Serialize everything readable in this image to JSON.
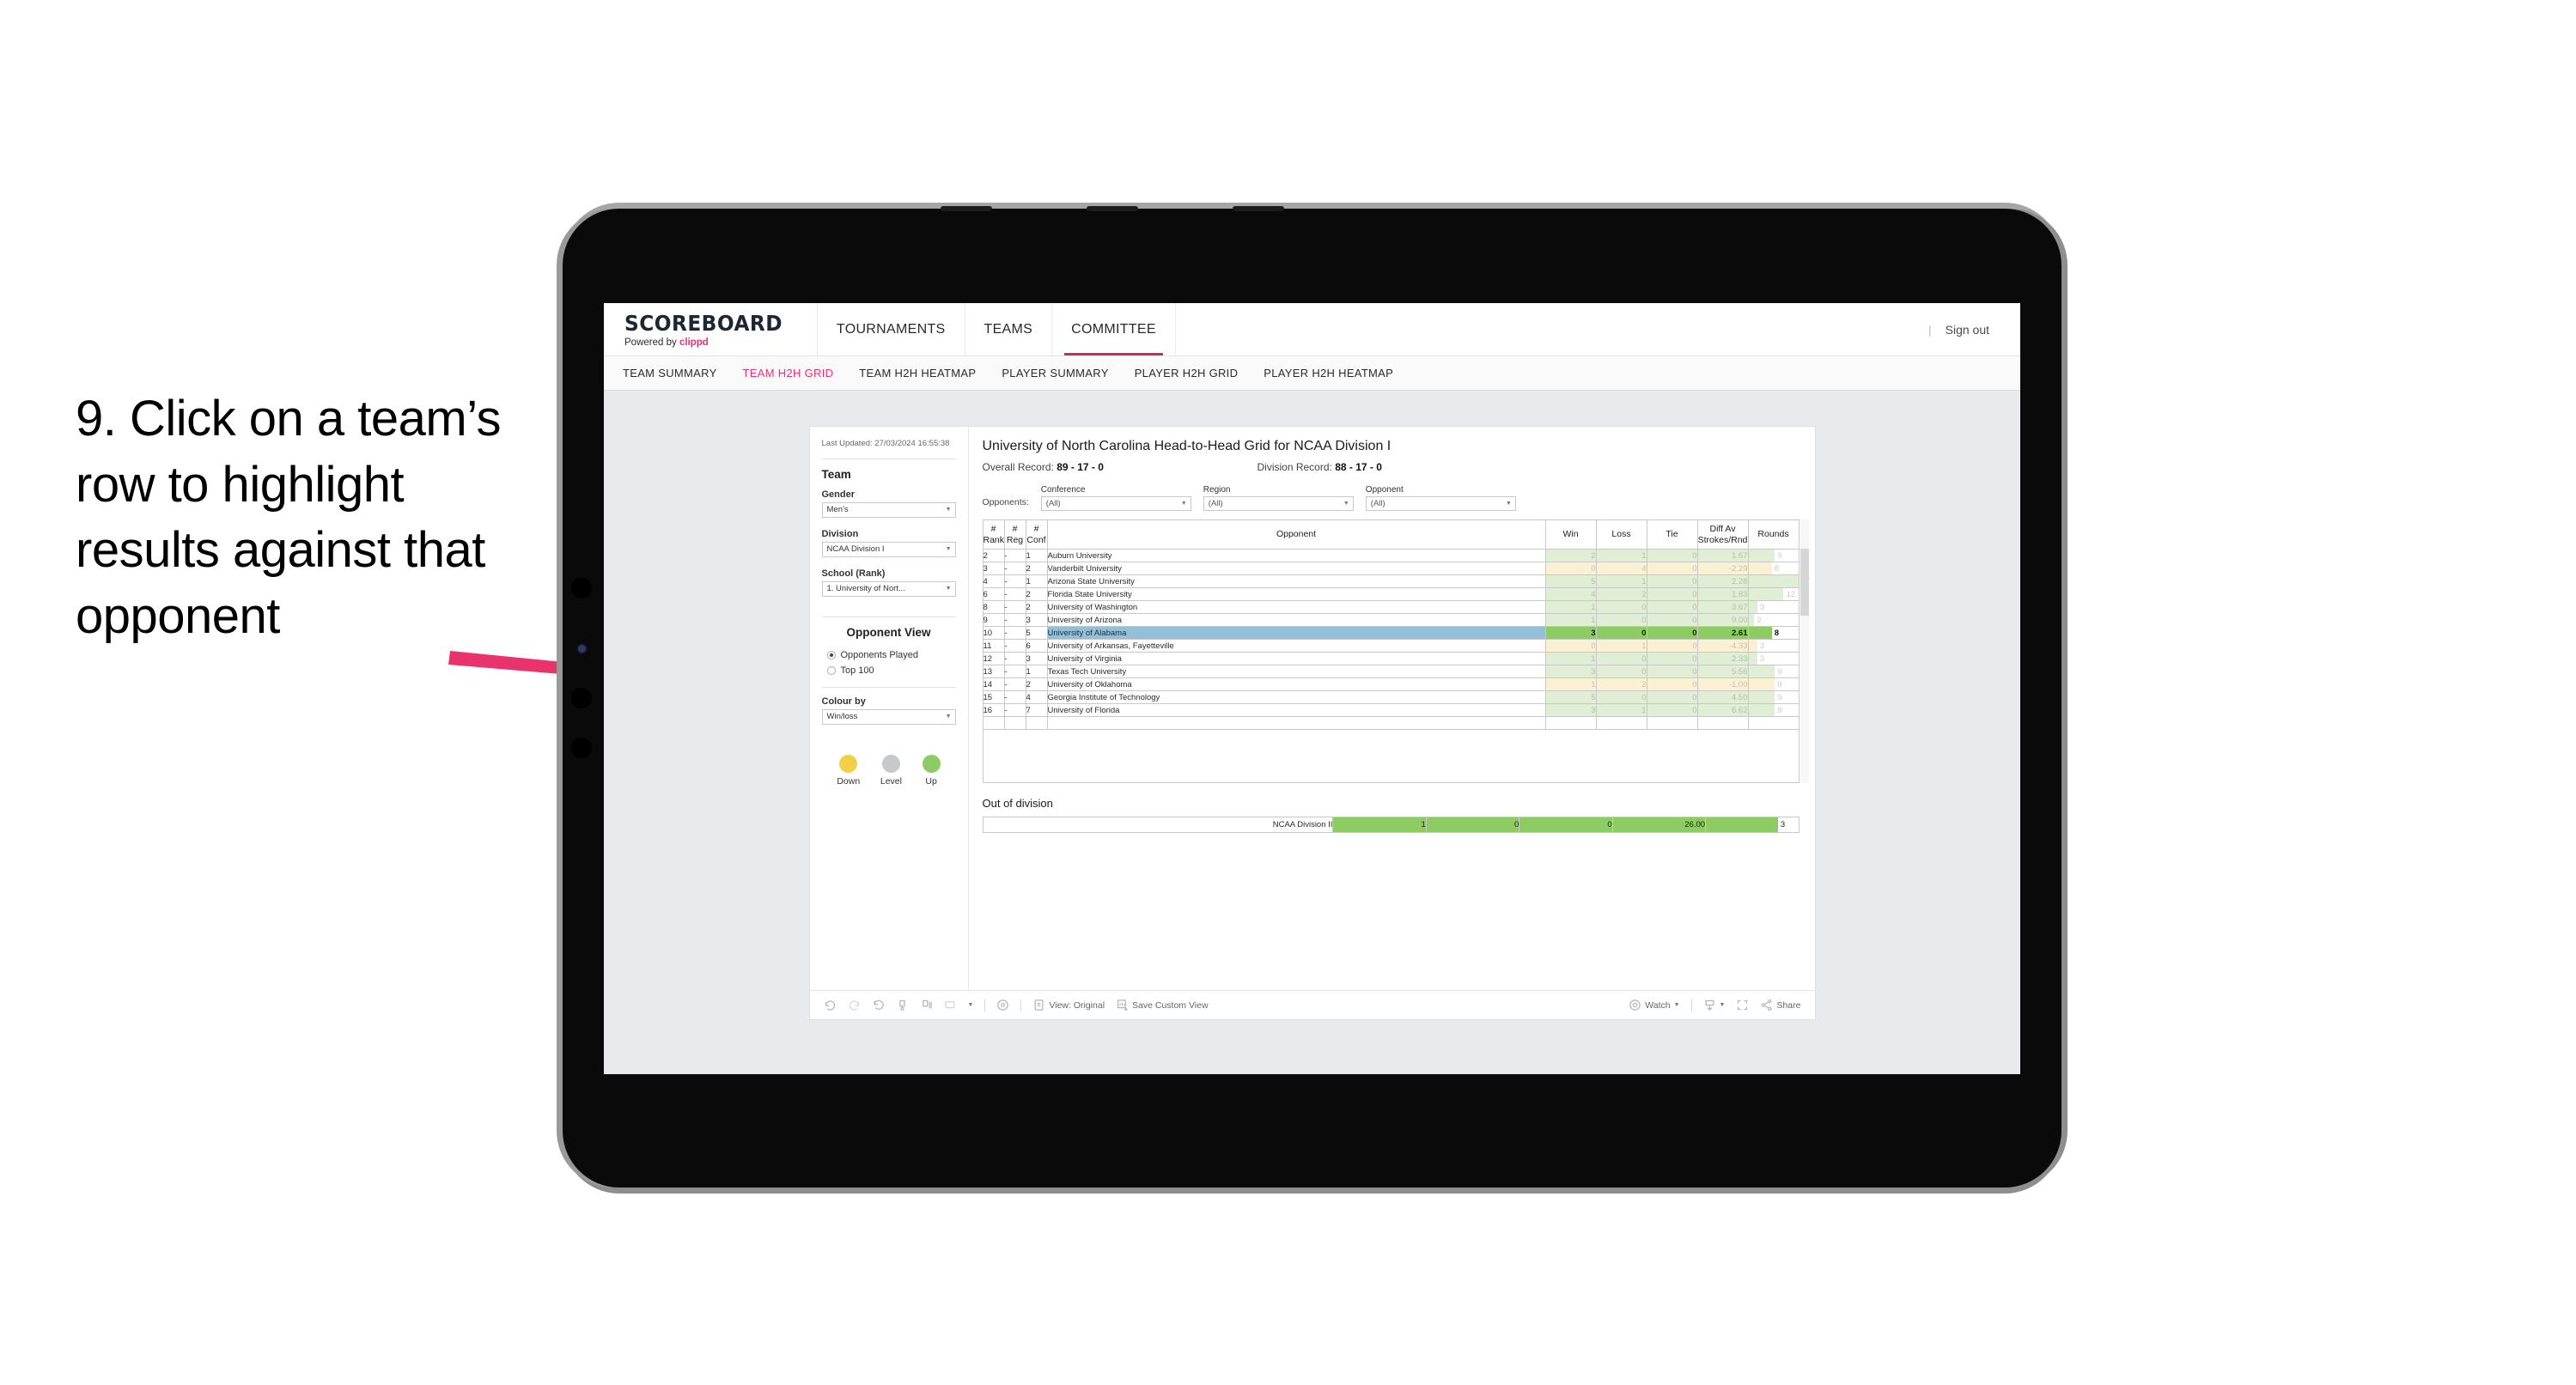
{
  "annotation": {
    "text": "9. Click on a team’s row to highlight results against that opponent",
    "arrow_color": "#e8336d"
  },
  "app": {
    "logo": {
      "main": "SCOREBOARD",
      "powered_prefix": "Powered by ",
      "brand": "clippd"
    },
    "top_nav": [
      {
        "label": "TOURNAMENTS",
        "active": false
      },
      {
        "label": "TEAMS",
        "active": false
      },
      {
        "label": "COMMITTEE",
        "active": true
      }
    ],
    "sign_out": "Sign out",
    "separator": "|",
    "sub_nav": [
      {
        "label": "TEAM SUMMARY",
        "active": false
      },
      {
        "label": "TEAM H2H GRID",
        "active": true
      },
      {
        "label": "TEAM H2H HEATMAP",
        "active": false
      },
      {
        "label": "PLAYER SUMMARY",
        "active": false
      },
      {
        "label": "PLAYER H2H GRID",
        "active": false
      },
      {
        "label": "PLAYER H2H HEATMAP",
        "active": false
      }
    ]
  },
  "sidebar": {
    "last_updated": "Last Updated: 27/03/2024 16:55:38",
    "team_heading": "Team",
    "gender": {
      "label": "Gender",
      "value": "Men’s"
    },
    "division": {
      "label": "Division",
      "value": "NCAA Division I"
    },
    "school": {
      "label": "School (Rank)",
      "value": "1. University of Nort..."
    },
    "opponent_view": {
      "heading": "Opponent View",
      "options": [
        {
          "label": "Opponents Played",
          "selected": true
        },
        {
          "label": "Top 100",
          "selected": false
        }
      ]
    },
    "colour_by": {
      "label": "Colour by",
      "value": "Win/loss"
    },
    "legend": [
      {
        "label": "Down",
        "color": "#f2d045"
      },
      {
        "label": "Level",
        "color": "#c6c9cc"
      },
      {
        "label": "Up",
        "color": "#8ccc63"
      }
    ]
  },
  "viz": {
    "title": "University of North Carolina Head-to-Head Grid for NCAA Division I",
    "overall_record_label": "Overall Record: ",
    "overall_record": "89 - 17 - 0",
    "division_record_label": "Division Record: ",
    "division_record": "88 - 17 - 0",
    "opponents_label": "Opponents:",
    "filters": [
      {
        "label": "Conference",
        "value": "(All)"
      },
      {
        "label": "Region",
        "value": "(All)"
      },
      {
        "label": "Opponent",
        "value": "(All)"
      }
    ],
    "out_of_division_title": "Out of division"
  },
  "chart_data": {
    "type": "table",
    "title": "University of North Carolina Head-to-Head Grid for NCAA Division I",
    "columns": [
      "# Rank",
      "# Reg",
      "# Conf",
      "Opponent",
      "Win",
      "Loss",
      "Tie",
      "Diff Av Strokes/Rnd",
      "Rounds"
    ],
    "rounds_max": 17,
    "rows": [
      {
        "rank": "2",
        "reg": "-",
        "conf": "1",
        "opponent": "Auburn University",
        "win": "2",
        "loss": "1",
        "tie": "0",
        "diff": "1.67",
        "rounds": 9,
        "tone": "up",
        "highlighted": false
      },
      {
        "rank": "3",
        "reg": "-",
        "conf": "2",
        "opponent": "Vanderbilt University",
        "win": "0",
        "loss": "4",
        "tie": "0",
        "diff": "-2.29",
        "rounds": 8,
        "tone": "down",
        "highlighted": false
      },
      {
        "rank": "4",
        "reg": "-",
        "conf": "1",
        "opponent": "Arizona State University",
        "win": "5",
        "loss": "1",
        "tie": "0",
        "diff": "2.28",
        "rounds": 17,
        "tone": "up",
        "highlighted": false
      },
      {
        "rank": "6",
        "reg": "-",
        "conf": "2",
        "opponent": "Florida State University",
        "win": "4",
        "loss": "2",
        "tie": "0",
        "diff": "1.83",
        "rounds": 12,
        "tone": "up",
        "highlighted": false
      },
      {
        "rank": "8",
        "reg": "-",
        "conf": "2",
        "opponent": "University of Washington",
        "win": "1",
        "loss": "0",
        "tie": "0",
        "diff": "3.67",
        "rounds": 3,
        "tone": "up",
        "highlighted": false
      },
      {
        "rank": "9",
        "reg": "-",
        "conf": "3",
        "opponent": "University of Arizona",
        "win": "1",
        "loss": "0",
        "tie": "0",
        "diff": "9.00",
        "rounds": 2,
        "tone": "up",
        "highlighted": false
      },
      {
        "rank": "10",
        "reg": "-",
        "conf": "5",
        "opponent": "University of Alabama",
        "win": "3",
        "loss": "0",
        "tie": "0",
        "diff": "2.61",
        "rounds": 8,
        "tone": "up",
        "highlighted": true
      },
      {
        "rank": "11",
        "reg": "-",
        "conf": "6",
        "opponent": "University of Arkansas, Fayetteville",
        "win": "0",
        "loss": "1",
        "tie": "0",
        "diff": "-4.33",
        "rounds": 3,
        "tone": "down",
        "highlighted": false
      },
      {
        "rank": "12",
        "reg": "-",
        "conf": "3",
        "opponent": "University of Virginia",
        "win": "1",
        "loss": "0",
        "tie": "0",
        "diff": "2.33",
        "rounds": 3,
        "tone": "up",
        "highlighted": false
      },
      {
        "rank": "13",
        "reg": "-",
        "conf": "1",
        "opponent": "Texas Tech University",
        "win": "3",
        "loss": "0",
        "tie": "0",
        "diff": "5.56",
        "rounds": 9,
        "tone": "up",
        "highlighted": false
      },
      {
        "rank": "14",
        "reg": "-",
        "conf": "2",
        "opponent": "University of Oklahoma",
        "win": "1",
        "loss": "2",
        "tie": "0",
        "diff": "-1.00",
        "rounds": 9,
        "tone": "down",
        "highlighted": false
      },
      {
        "rank": "15",
        "reg": "-",
        "conf": "4",
        "opponent": "Georgia Institute of Technology",
        "win": "5",
        "loss": "0",
        "tie": "0",
        "diff": "4.50",
        "rounds": 9,
        "tone": "up",
        "highlighted": false
      },
      {
        "rank": "16",
        "reg": "-",
        "conf": "7",
        "opponent": "University of Florida",
        "win": "3",
        "loss": "1",
        "tie": "0",
        "diff": "6.62",
        "rounds": 9,
        "tone": "up",
        "highlighted": false
      }
    ],
    "out_of_division": {
      "name": "NCAA Division II",
      "win": "1",
      "loss": "0",
      "tie": "0",
      "diff": "26.00",
      "rounds": 3
    }
  },
  "toolbar": {
    "view_label": "View: Original",
    "save_label": "Save Custom View",
    "watch_label": "Watch",
    "share_label": "Share"
  }
}
